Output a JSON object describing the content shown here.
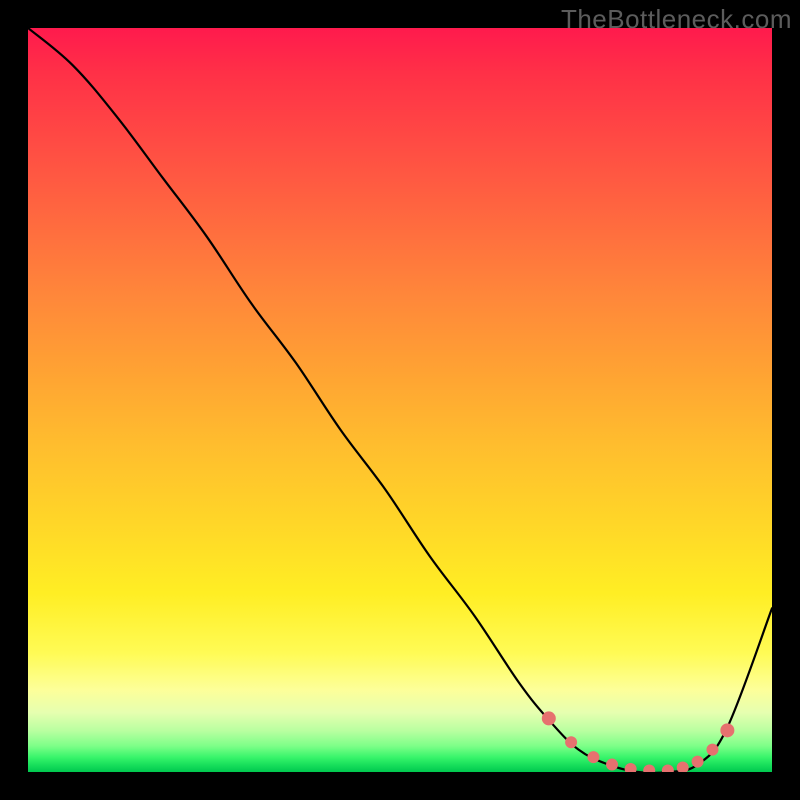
{
  "watermark": "TheBottleneck.com",
  "chart_data": {
    "type": "line",
    "title": "",
    "xlabel": "",
    "ylabel": "",
    "xlim": [
      0,
      100
    ],
    "ylim": [
      0,
      100
    ],
    "grid": false,
    "series": [
      {
        "name": "bottleneck-curve",
        "x": [
          0,
          6,
          12,
          18,
          24,
          30,
          36,
          42,
          48,
          54,
          60,
          66,
          70,
          74,
          78,
          82,
          86,
          90,
          94,
          100
        ],
        "values": [
          100,
          95,
          88,
          80,
          72,
          63,
          55,
          46,
          38,
          29,
          21,
          12,
          7,
          3,
          1,
          0,
          0,
          1,
          6,
          22
        ]
      }
    ],
    "marker_points": {
      "name": "highlight-dots",
      "x": [
        70,
        73,
        76,
        78.5,
        81,
        83.5,
        86,
        88,
        90,
        92,
        94
      ],
      "values": [
        7.2,
        4.0,
        2.0,
        1.0,
        0.4,
        0.2,
        0.2,
        0.6,
        1.4,
        3.0,
        5.6
      ]
    },
    "colors": {
      "curve": "#000000",
      "dots": "#e6716f",
      "gradient_top": "#ff1a4d",
      "gradient_mid": "#ffd528",
      "gradient_bottom": "#00c84f"
    }
  }
}
